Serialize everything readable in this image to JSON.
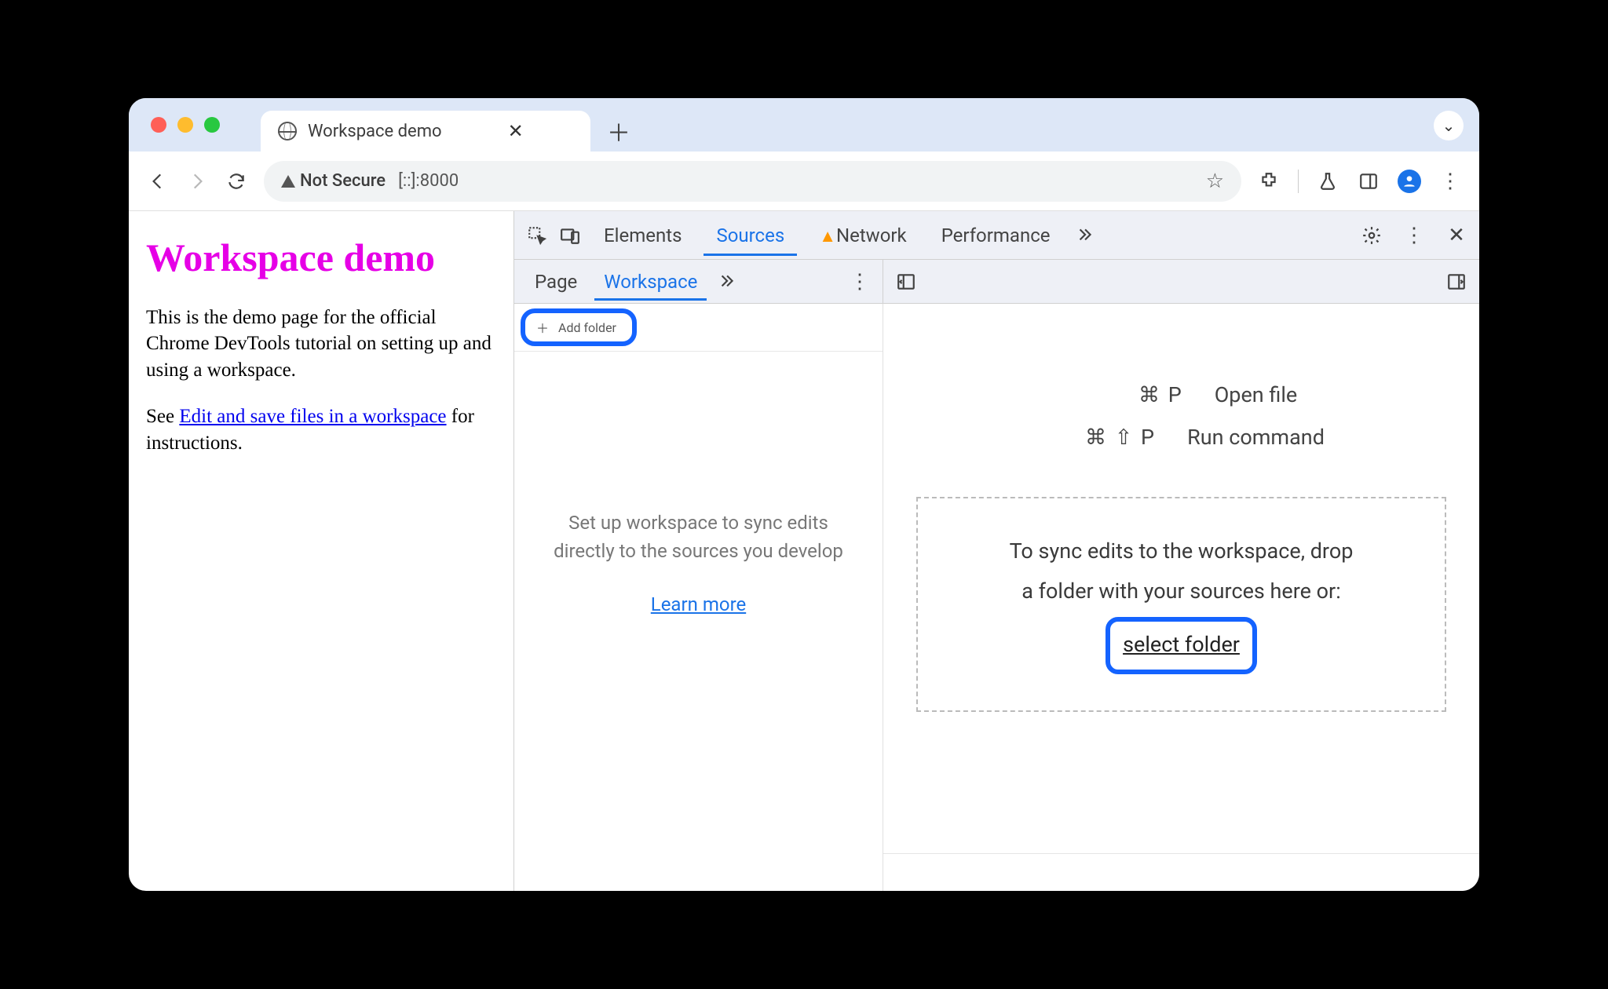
{
  "browser": {
    "tab_title": "Workspace demo",
    "address": {
      "badge": "Not Secure",
      "url": "[::]:8000"
    },
    "tabs_chevron": "⌄"
  },
  "page": {
    "heading": "Workspace demo",
    "para1": "This is the demo page for the official Chrome DevTools tutorial on setting up and using a workspace.",
    "para2a": "See ",
    "link": "Edit and save files in a workspace",
    "para2b": " for instructions."
  },
  "devtools": {
    "tabs": {
      "elements": "Elements",
      "sources": "Sources",
      "network": "Network",
      "performance": "Performance"
    },
    "subtabs": {
      "page": "Page",
      "workspace": "Workspace"
    },
    "add_folder": "Add folder",
    "nav_hint": "Set up workspace to sync edits directly to the sources you develop",
    "learn_more": "Learn more",
    "shortcut_open_keys": "⌘ P",
    "shortcut_open_label": "Open file",
    "shortcut_run_keys": "⌘ ⇧ P",
    "shortcut_run_label": "Run command",
    "drop_line1": "To sync edits to the workspace, drop",
    "drop_line2": "a folder with your sources here or:",
    "select_folder": "select folder"
  }
}
